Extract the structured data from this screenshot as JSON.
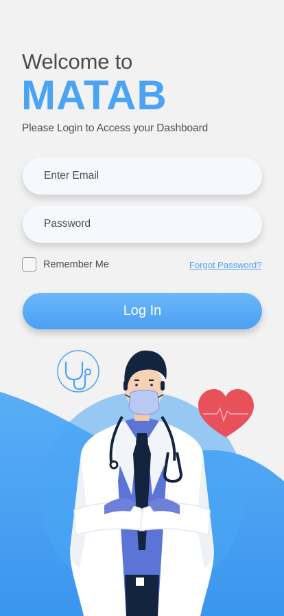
{
  "header": {
    "welcome": "Welcome to",
    "brand": "MATAB",
    "subtitle": "Please Login to Access your Dashboard"
  },
  "form": {
    "email_placeholder": "Enter Email",
    "password_placeholder": "Password",
    "remember_label": "Remember Me",
    "remember_checked": false,
    "forgot_label": "Forgot Password?",
    "login_label": "Log In"
  },
  "illustration": {
    "icons": [
      "stethoscope-icon",
      "heart-icon",
      "doctor-illustration"
    ]
  },
  "colors": {
    "brand": "#4aa3f4",
    "background": "#f2f2f2",
    "wave": "#3f9cf0",
    "heart": "#e8505b"
  }
}
